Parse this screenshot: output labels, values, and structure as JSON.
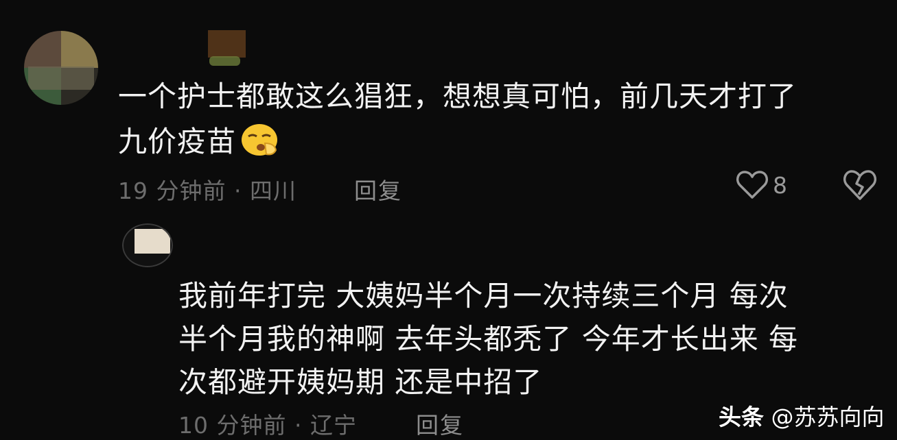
{
  "comment": {
    "text_line1": "一个护士都敢这么猖狂，想想真可怕，前几天才打了",
    "text_line2": "九价疫苗",
    "emoji": "shushing-face-emoji",
    "meta": "19 分钟前 · 四川",
    "reply_label": "回复",
    "like_count": "8"
  },
  "reply": {
    "text_line1": "我前年打完  大姨妈半个月一次持续三个月  每次",
    "text_line2": "半个月我的神啊  去年头都秃了  今年才长出来  每",
    "text_line3": "次都避开姨妈期  还是中招了",
    "meta": "10 分钟前 · 辽宁",
    "reply_label": "回复"
  },
  "watermark": {
    "brand": "头条",
    "handle": "@苏苏向向"
  },
  "colors": {
    "background": "#0b0b0b",
    "text": "#f2f2f2",
    "meta": "#6d6d6d"
  }
}
